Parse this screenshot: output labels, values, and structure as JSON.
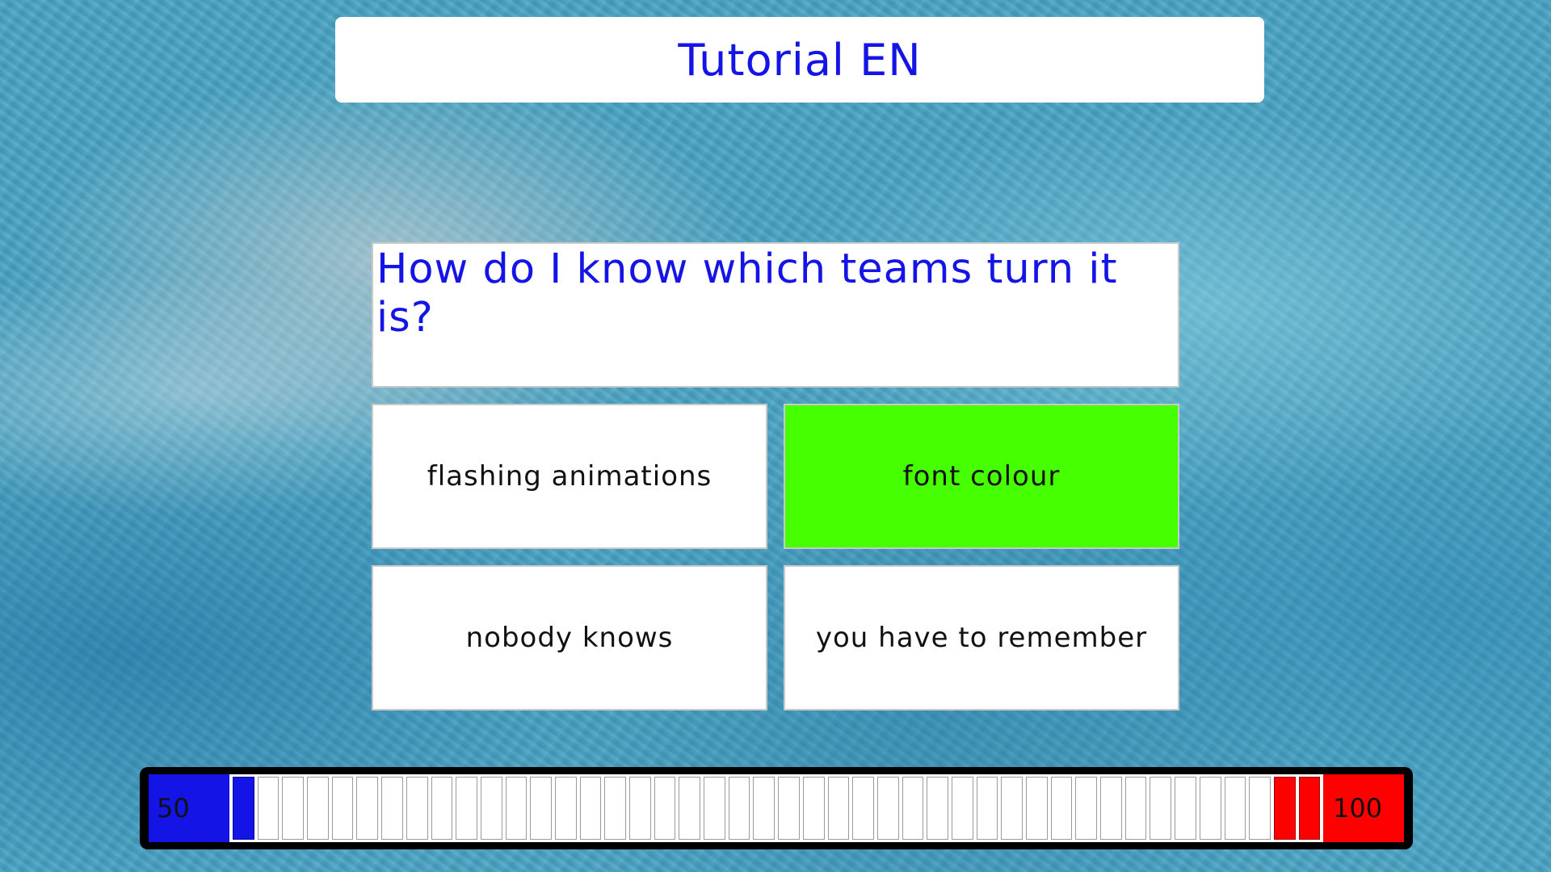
{
  "header": {
    "title": "Tutorial EN"
  },
  "question": {
    "text": "How do I know which teams turn it is?"
  },
  "answers": [
    {
      "label": "flashing animations",
      "state": "default"
    },
    {
      "label": "font colour",
      "state": "correct"
    },
    {
      "label": "nobody knows",
      "state": "default"
    },
    {
      "label": "you have to remember",
      "state": "default"
    }
  ],
  "scoreboard": {
    "blue_score": "50",
    "red_score": "100",
    "total_cells": 44,
    "blue_filled_cells": 1,
    "red_filled_cells": 2
  },
  "colors": {
    "team_blue": "#1414e6",
    "team_red": "#ff0000",
    "correct_answer": "#46ff00"
  }
}
